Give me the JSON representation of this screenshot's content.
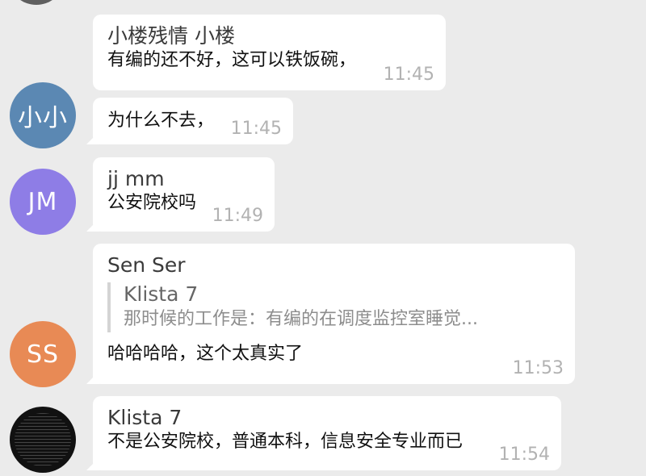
{
  "messages": [
    {
      "sender": "小楼残情 小楼",
      "text": "有编的还不好，这可以铁饭碗，",
      "time": "11:45"
    },
    {
      "avatar_text": "小小",
      "avatar_color": "#5b88b3",
      "text": "为什么不去，",
      "time": "11:45"
    },
    {
      "avatar_text": "JM",
      "avatar_color": "#8e7de6",
      "sender": "jj mm",
      "text": "公安院校吗",
      "time": "11:49"
    },
    {
      "avatar_text": "SS",
      "avatar_color": "#e88a55",
      "sender": "Sen Ser",
      "quote": {
        "name": "Klista 7",
        "text": "那时候的工作是：有编的在调度监控室睡觉..."
      },
      "text": "哈哈哈哈，这个太真实了",
      "time": "11:53"
    },
    {
      "sender": "Klista 7",
      "text": "不是公安院校，普通本科，信息安全专业而已",
      "time": "11:54"
    }
  ]
}
